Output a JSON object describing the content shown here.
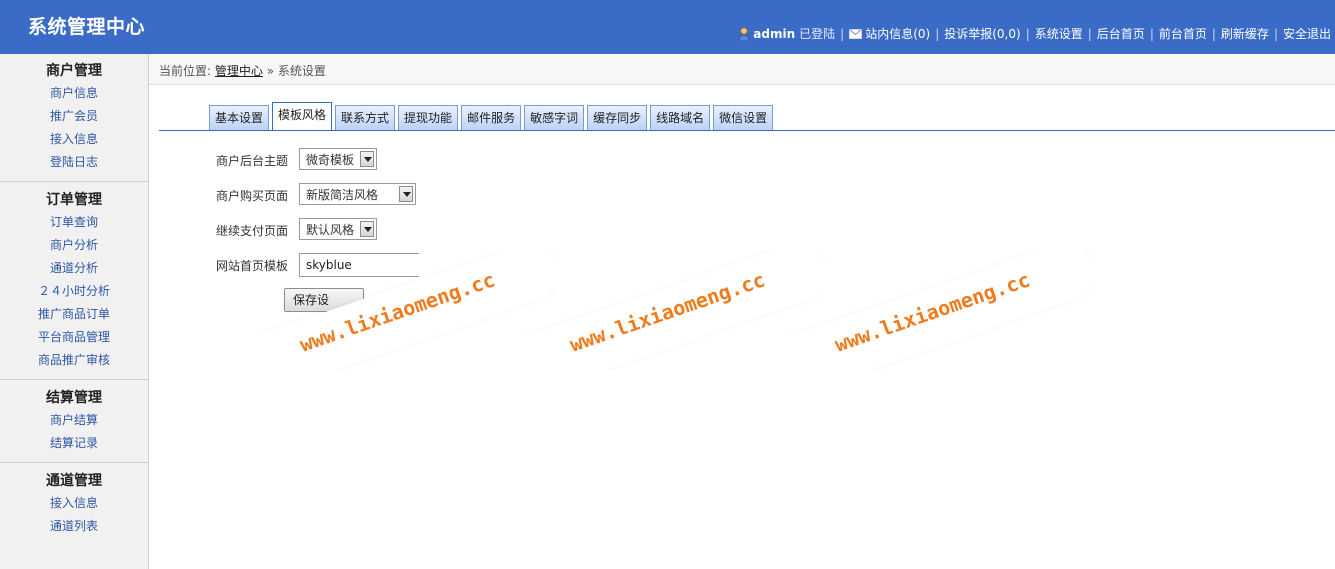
{
  "header": {
    "title": "系统管理中心",
    "user": "admin",
    "login_status": "已登陆",
    "links": [
      "站内信息(0)",
      "投诉举报(0,0)",
      "系统设置",
      "后台首页",
      "前台首页",
      "刷新缓存",
      "安全退出"
    ]
  },
  "sidebar": {
    "groups": [
      {
        "title": "商户管理",
        "items": [
          "商户信息",
          "推广会员",
          "接入信息",
          "登陆日志"
        ]
      },
      {
        "title": "订单管理",
        "items": [
          "订单查询",
          "商户分析",
          "通道分析",
          "２４小时分析",
          "推广商品订单",
          "平台商品管理",
          "商品推广审核"
        ]
      },
      {
        "title": "结算管理",
        "items": [
          "商户结算",
          "结算记录"
        ]
      },
      {
        "title": "通道管理",
        "items": [
          "接入信息",
          "通道列表"
        ]
      }
    ]
  },
  "breadcrumb": {
    "prefix": "当前位置:",
    "home": "管理中心",
    "separator": "»",
    "current": "系统设置"
  },
  "tabs": [
    "基本设置",
    "模板风格",
    "联系方式",
    "提现功能",
    "邮件服务",
    "敏感字词",
    "缓存同步",
    "线路域名",
    "微信设置"
  ],
  "active_tab": "模板风格",
  "form": {
    "merchant_theme": {
      "label": "商户后台主题",
      "value": "微奇模板"
    },
    "buy_page": {
      "label": "商户购买页面",
      "value": "新版简洁风格"
    },
    "continue_pay": {
      "label": "继续支付页面",
      "value": "默认风格"
    },
    "home_template": {
      "label": "网站首页模板",
      "value": "skyblue"
    },
    "save_label": "保存设"
  },
  "watermark": "www.lixiaomeng.cc",
  "colors": {
    "header_bg": "#3a6bc6",
    "sidebar_bg": "#f1f1f1",
    "watermark": "#f07b1c"
  }
}
